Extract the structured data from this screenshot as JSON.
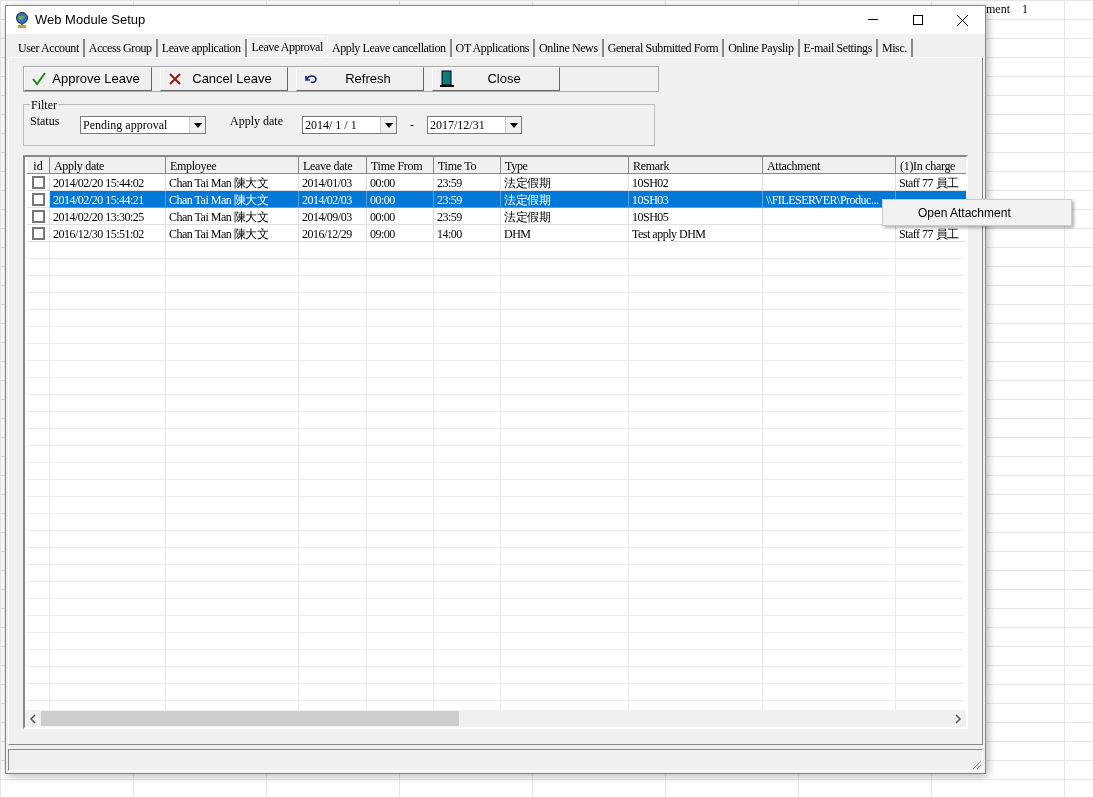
{
  "background_cells": [
    "ment",
    "1"
  ],
  "window": {
    "title": "Web Module Setup"
  },
  "tabs": [
    {
      "label": "User Account",
      "selected": false
    },
    {
      "label": "Access Group",
      "selected": false
    },
    {
      "label": "Leave application",
      "selected": false
    },
    {
      "label": "Leave Approval",
      "selected": true
    },
    {
      "label": "Apply Leave cancellation",
      "selected": false
    },
    {
      "label": "OT Applications",
      "selected": false
    },
    {
      "label": "Online News",
      "selected": false
    },
    {
      "label": "General Submitted Form",
      "selected": false
    },
    {
      "label": "Online Payslip",
      "selected": false
    },
    {
      "label": "E-mail Settings",
      "selected": false
    },
    {
      "label": "Misc.",
      "selected": false
    }
  ],
  "toolbar": [
    {
      "kind": "approve",
      "label": "Approve Leave"
    },
    {
      "kind": "cancel",
      "label": "Cancel Leave"
    },
    {
      "kind": "refresh",
      "label": "Refresh"
    },
    {
      "kind": "close",
      "label": "Close"
    }
  ],
  "filter": {
    "title": "Filter",
    "status_label": "Status",
    "status_value": "Pending approval",
    "date_label": "Apply date",
    "date_from": "2014/ 1 / 1",
    "separator": "-",
    "date_to": "2017/12/31"
  },
  "table": {
    "checkbox_header": "id",
    "columns": [
      "Apply date",
      "Employee",
      "Leave date",
      "Time From",
      "Time To",
      "Type",
      "Remark",
      "Attachment",
      "(1)In charge"
    ],
    "rows": [
      {
        "checked": false,
        "selected": false,
        "cells": [
          "2014/02/20 15:44:02",
          "Chan Tai Man 陳大文",
          "2014/01/03",
          "00:00",
          "23:59",
          "法定假期",
          "10SH02",
          "",
          "Staff 77 員工"
        ]
      },
      {
        "checked": false,
        "selected": true,
        "cells": [
          "2014/02/20 15:44:21",
          "Chan Tai Man 陳大文",
          "2014/02/03",
          "00:00",
          "23:59",
          "法定假期",
          "10SH03",
          "\\\\FILESERVER\\Produc...",
          ""
        ]
      },
      {
        "checked": false,
        "selected": false,
        "cells": [
          "2014/02/20 13:30:25",
          "Chan Tai Man 陳大文",
          "2014/09/03",
          "00:00",
          "23:59",
          "法定假期",
          "10SH05",
          "",
          ""
        ]
      },
      {
        "checked": false,
        "selected": false,
        "cells": [
          "2016/12/30 15:51:02",
          "Chan Tai Man 陳大文",
          "2016/12/29",
          "09:00",
          "14:00",
          "DHM",
          "Test apply DHM",
          "",
          "Staff 77 員工"
        ]
      }
    ]
  },
  "context_menu": {
    "items": [
      "Open Attachment"
    ]
  }
}
